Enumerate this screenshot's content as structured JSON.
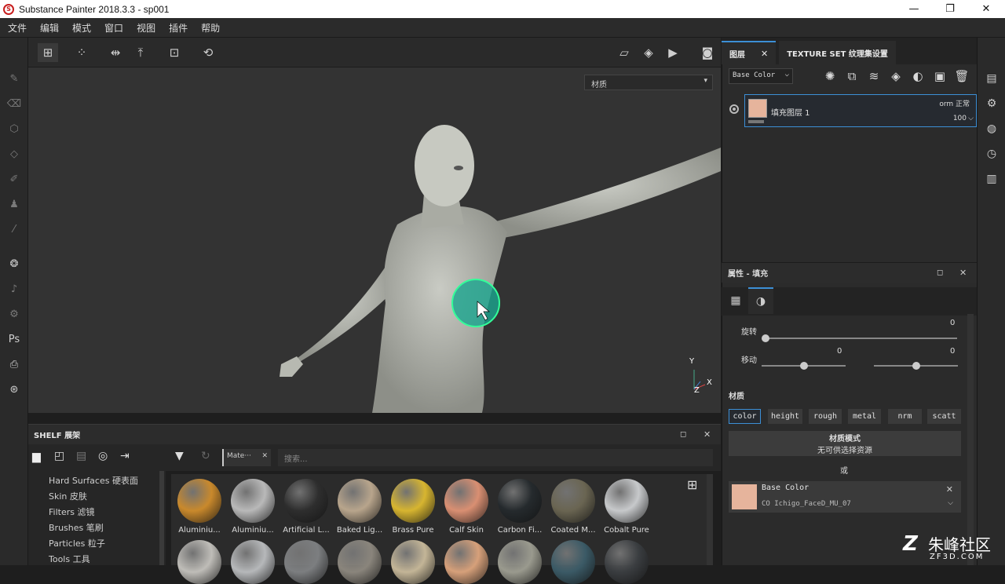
{
  "window": {
    "title": "Substance Painter 2018.3.3 - sp001",
    "logo": "S"
  },
  "window_buttons": {
    "minimize": "—",
    "restore": "❐",
    "close": "✕"
  },
  "menu": [
    "文件",
    "编辑",
    "模式",
    "窗口",
    "视图",
    "插件",
    "帮助"
  ],
  "viewport": {
    "material_select": "材质",
    "axis_y": "Y",
    "axis_x": "X",
    "axis_z": "Z"
  },
  "shelf": {
    "title": "SHELF 展架",
    "filter_tag": "Mate···",
    "search_placeholder": "搜索...",
    "categories": [
      "Hard Surfaces 硬表面",
      "Skin 皮肤",
      "Filters 滤镜",
      "Brushes 笔刷",
      "Particles 粒子",
      "Tools 工具"
    ],
    "materials": [
      {
        "label": "Aluminiu...",
        "color": "#c9892c"
      },
      {
        "label": "Aluminiu...",
        "color": "#b9b9b9"
      },
      {
        "label": "Artificial L...",
        "color": "#2e2e2e"
      },
      {
        "label": "Baked Lig...",
        "color": "#b8a58c"
      },
      {
        "label": "Brass Pure",
        "color": "#d7b530"
      },
      {
        "label": "Calf Skin",
        "color": "#d98f72"
      },
      {
        "label": "Carbon Fi...",
        "color": "#252a2d"
      },
      {
        "label": "Coated M...",
        "color": "#6a6552"
      },
      {
        "label": "Cobalt Pure",
        "color": "#c7c9cb"
      }
    ],
    "materials_row2_colors": [
      "#bfbdb8",
      "#b6b8ba",
      "#7c7e80",
      "#8a857c",
      "#c3b597",
      "#d6a07a",
      "#9a9a8e",
      "#3b5a66",
      "#3a3d40"
    ]
  },
  "layers": {
    "tab_layers": "图层",
    "tab_texture_set": "TEXTURE SET 纹理集设置",
    "channel_dropdown": "Base Color",
    "items": [
      {
        "name": "填充图层 1",
        "blend": "orm 正常",
        "opacity": "100"
      }
    ]
  },
  "properties": {
    "title": "属性 - 填充",
    "rotation_label": "旋转",
    "rotation_value": "0",
    "rotation_fraction": 0.0,
    "offset_label": "移动",
    "offset_value_1": "0",
    "offset_value_2": "0",
    "offset_fraction_1": 0.5,
    "offset_fraction_2": 0.5,
    "material_section": "材质",
    "channels": [
      "color",
      "height",
      "rough",
      "metal",
      "nrm",
      "scatt"
    ],
    "active_channel": "color",
    "material_mode_title": "材质模式",
    "material_mode_sub": "无可供选择资源",
    "or_label": "或",
    "basecolor_title": "Base Color",
    "basecolor_file": "CO Ichigo_FaceD_MU_07"
  },
  "watermark": {
    "text": "朱峰社区",
    "sub": "ZF3D.COM"
  }
}
